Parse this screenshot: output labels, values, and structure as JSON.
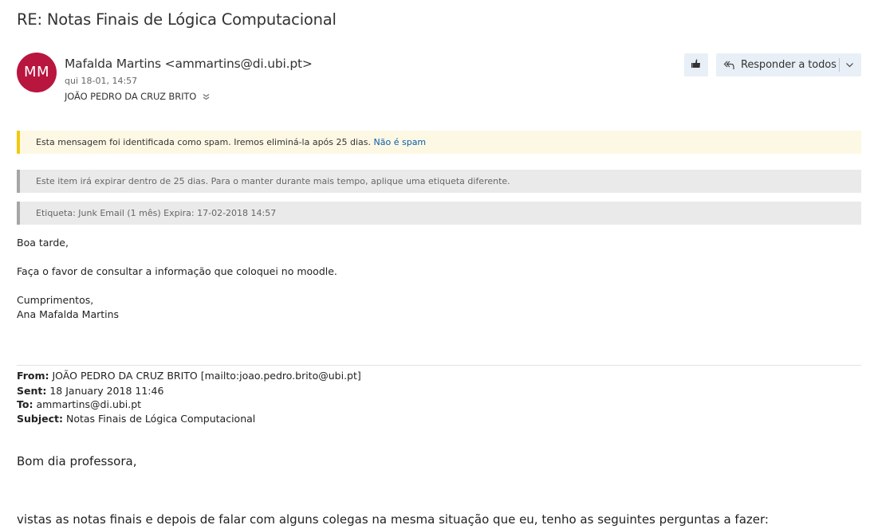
{
  "email": {
    "subject": "RE: Notas Finais de Lógica Computacional",
    "avatar_initials": "MM",
    "avatar_color": "#b8153f",
    "sender": "Mafalda Martins <ammartins@di.ubi.pt>",
    "date": "qui 18-01, 14:57",
    "recipient": "JOÃO PEDRO DA CRUZ BRITO"
  },
  "toolbar": {
    "like_icon": "thumbs-up-icon",
    "reply_all_label": "Responder a todos",
    "reply_all_icon": "reply-all-icon",
    "dropdown_icon": "chevron-down-icon"
  },
  "banners": {
    "spam_text": "Esta mensagem foi identificada como spam. Iremos eliminá-la após 25 dias.",
    "spam_link": "Não é spam",
    "expire_text": "Este item irá expirar dentro de 25 dias. Para o manter durante mais tempo, aplique uma etiqueta diferente.",
    "label_text": "Etiqueta: Junk Email (1 mês) Expira: 17-02-2018 14:57"
  },
  "body": {
    "greeting": "Boa tarde,",
    "line1": "Faça o favor de consultar a informação que coloquei no moodle.",
    "closing": "Cumprimentos,",
    "signature": "Ana Mafalda Martins"
  },
  "quoted": {
    "from_label": "From:",
    "from_value": "JOÃO PEDRO DA CRUZ BRITO [mailto:joao.pedro.brito@ubi.pt]",
    "sent_label": "Sent:",
    "sent_value": "18 January 2018 11:46",
    "to_label": "To:",
    "to_value": "ammartins@di.ubi.pt",
    "subject_label": "Subject:",
    "subject_value": "Notas Finais de Lógica Computacional",
    "greeting": "Bom dia professora,",
    "line1": "vistas as notas finais e depois de falar com alguns colegas na mesma situação que eu, tenho as seguintes perguntas a fazer:"
  }
}
